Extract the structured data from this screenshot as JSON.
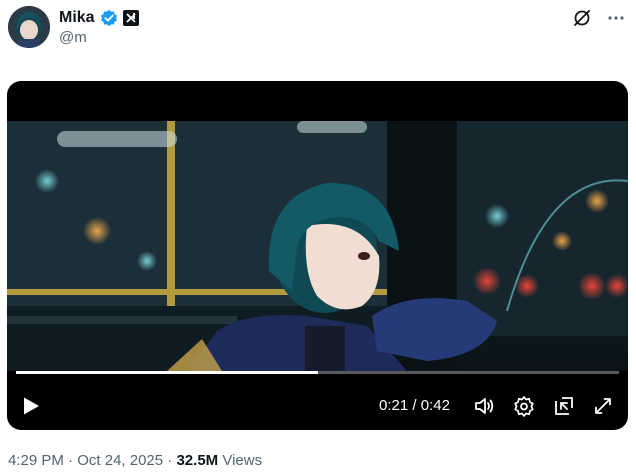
{
  "author": {
    "display_name": "Mika",
    "handle": "@m",
    "verified_color": "#1d9bf0"
  },
  "top_icons": [
    "grok-icon",
    "more-icon"
  ],
  "video": {
    "current_time": "0:21",
    "separator": "/",
    "duration": "0:42",
    "progress_fraction": 0.5,
    "controls": [
      "play-icon",
      "volume-icon",
      "settings-icon",
      "minimize-icon",
      "fullscreen-icon"
    ]
  },
  "meta": {
    "time": "4:29 PM",
    "dot1": "·",
    "date": "Oct 24, 2025",
    "dot2": "·",
    "views_count": "32.5M",
    "views_label": "Views"
  }
}
